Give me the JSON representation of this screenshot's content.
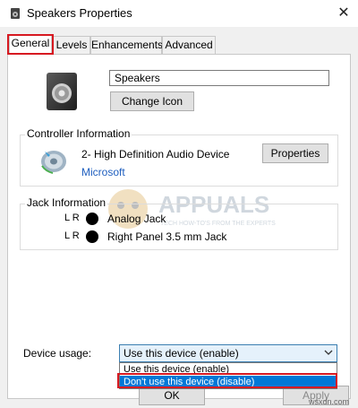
{
  "window": {
    "title": "Speakers Properties",
    "close_glyph": "✕"
  },
  "tabs": [
    {
      "label": "General",
      "active": true
    },
    {
      "label": "Levels"
    },
    {
      "label": "Enhancements"
    },
    {
      "label": "Advanced"
    }
  ],
  "general": {
    "device_name": "Speakers",
    "change_icon_label": "Change Icon"
  },
  "controller": {
    "group_label": "Controller Information",
    "device": "2- High Definition Audio Device",
    "manufacturer": "Microsoft",
    "properties_label": "Properties"
  },
  "jack": {
    "group_label": "Jack Information",
    "rows": [
      {
        "lr": "L R",
        "name": "Analog Jack"
      },
      {
        "lr": "L R",
        "name": "Right Panel 3.5 mm Jack"
      }
    ]
  },
  "watermark": {
    "brand": "APPUALS",
    "tagline": "TECH HOW-TO'S FROM THE EXPERTS"
  },
  "usage": {
    "label": "Device usage:",
    "selected": "Use this device (enable)",
    "options": [
      {
        "label": "Use this device (enable)"
      },
      {
        "label": "Don't use this device (disable)",
        "highlighted": true
      }
    ]
  },
  "footer": {
    "ok_label": "OK",
    "apply_label": "Apply",
    "site_watermark": "wsxdn.com"
  },
  "colors": {
    "highlight_red": "#d71921",
    "selection_blue": "#0078d7",
    "link_blue": "#1f5fbf"
  }
}
